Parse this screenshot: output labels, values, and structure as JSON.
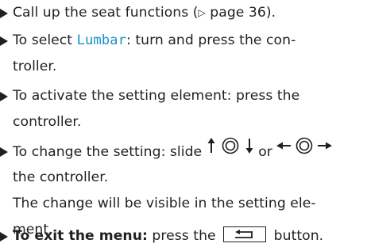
{
  "steps": [
    {
      "lines": [
        {
          "pre": "Call up the seat functions (",
          "ref_icon": "▷",
          "post": " page 36)."
        }
      ]
    },
    {
      "line1_pre": "To select ",
      "highlight": "Lumbar",
      "line1_post": ": turn and press the con-",
      "line2": "troller."
    },
    {
      "line1": "To activate the setting element: press the",
      "line2": "controller."
    },
    {
      "line1_pre": "To change the setting: slide ",
      "line1_mid": " or ",
      "line1_post": "",
      "line2": "the controller.",
      "line3": "The change will be visible in the setting ele-",
      "line4": "ment."
    },
    {
      "bold": "To exit the menu:",
      "pre": " press the ",
      "post": " button."
    }
  ],
  "icons": {
    "bullet": "triangle-bullet-icon",
    "page_ref": "page-reference-triangle-icon",
    "vertical_slide": "controller-slide-up-down-icon",
    "horizontal_slide": "controller-slide-left-right-icon",
    "back_button": "back-button-icon"
  },
  "colors": {
    "text": "#231f20",
    "highlight": "#1a91c8"
  }
}
